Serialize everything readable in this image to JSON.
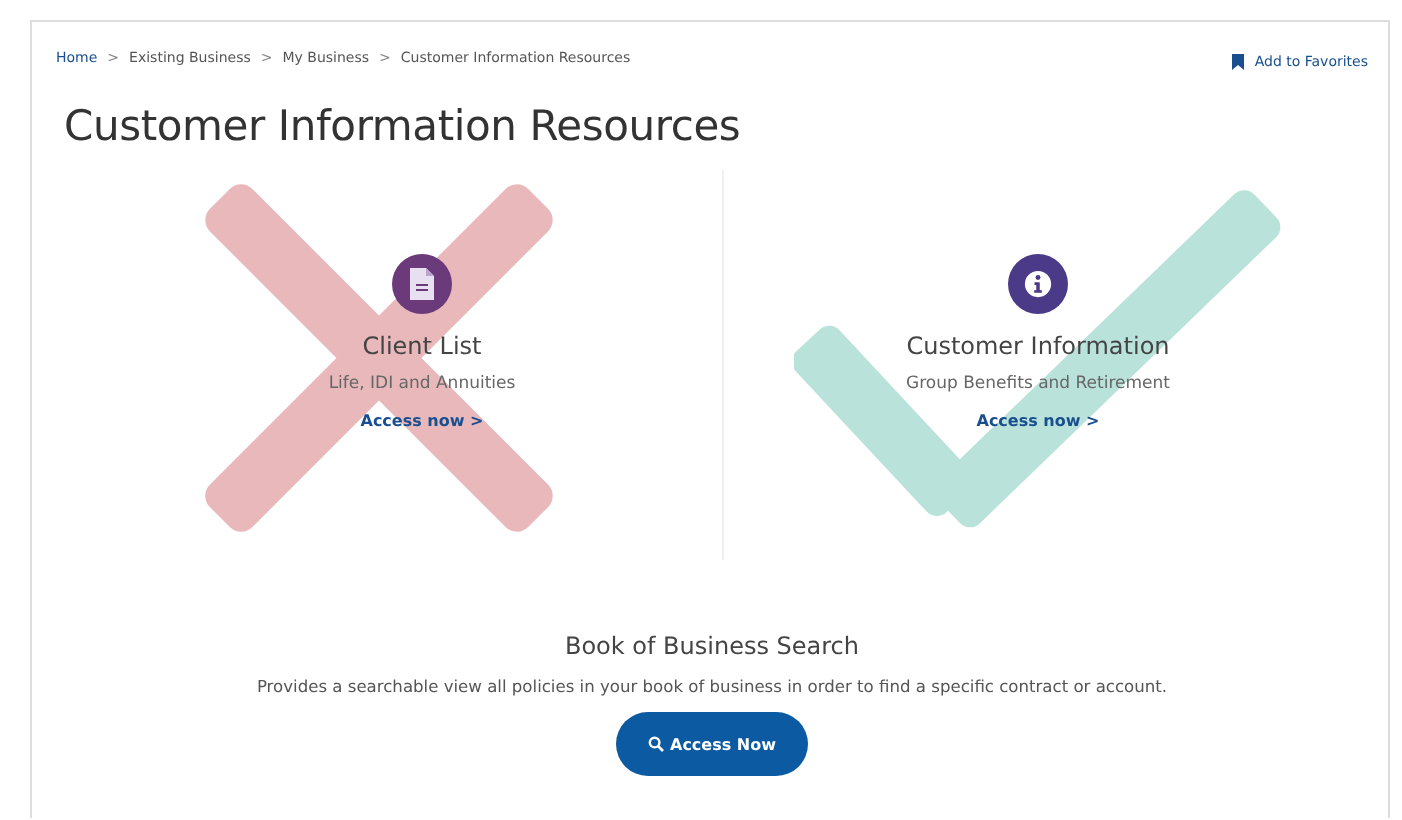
{
  "breadcrumb": [
    {
      "label": "Home",
      "link": true
    },
    {
      "label": "Existing Business",
      "link": false
    },
    {
      "label": "My Business",
      "link": false
    },
    {
      "label": "Customer Information Resources",
      "link": false
    }
  ],
  "breadcrumb_separator": ">",
  "favorites": {
    "label": "Add to Favorites"
  },
  "title": "Customer Information Resources",
  "cards": [
    {
      "kind": "crossed",
      "title": "Client List",
      "subtitle": "Life, IDI and Annuities",
      "link": "Access now",
      "link_arrow": ">"
    },
    {
      "kind": "checked",
      "title": "Customer Information",
      "subtitle": "Group Benefits and Retirement",
      "link": "Access now",
      "link_arrow": ">"
    }
  ],
  "search_section": {
    "title": "Book of Business Search",
    "description": "Provides a searchable view all policies in your book of business in order to find a specific contract or account.",
    "button": "Access Now"
  }
}
